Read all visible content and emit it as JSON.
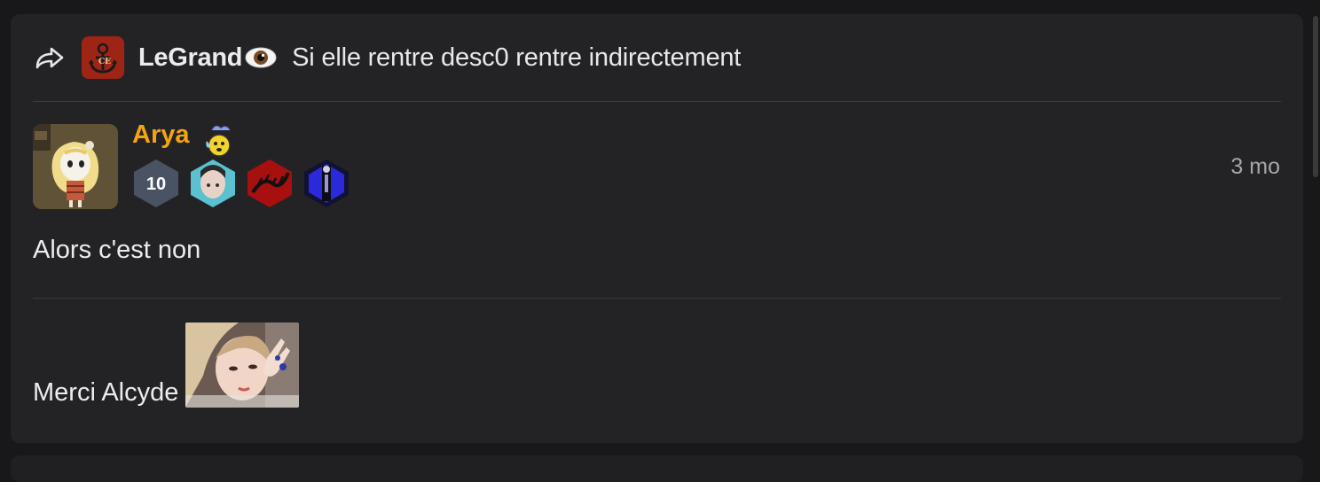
{
  "reply": {
    "icon": "reply-arrow-icon",
    "avatar_icon": "anchor-ship-avatar",
    "username": "LeGrand",
    "emoji": "eye-emoji",
    "text": "Si elle rentre desc0 rentre indirectement"
  },
  "post": {
    "author": {
      "name": "Arya",
      "name_color": "#f5a30f",
      "status_emoji": "sweating-face-emoji",
      "avatar": "blonde-girl-avatar"
    },
    "badges": [
      {
        "label": "10",
        "type": "level-badge",
        "color": "#4a5363"
      },
      {
        "label": "",
        "type": "portrait-badge",
        "color": "#5bc0d0"
      },
      {
        "label": "",
        "type": "red-dragon-badge",
        "color": "#a80f0f"
      },
      {
        "label": "",
        "type": "blue-figure-badge",
        "color": "#2a2ad8"
      }
    ],
    "timestamp": "3 mo",
    "body": "Alors c'est non",
    "second_message": "Merci Alcyde",
    "second_image": "selfie-peace-sign-image"
  },
  "colors": {
    "background": "#18181b",
    "card": "#232326",
    "divider": "#3b3b3f",
    "text": "#ececec",
    "muted": "#a6a6aa"
  }
}
